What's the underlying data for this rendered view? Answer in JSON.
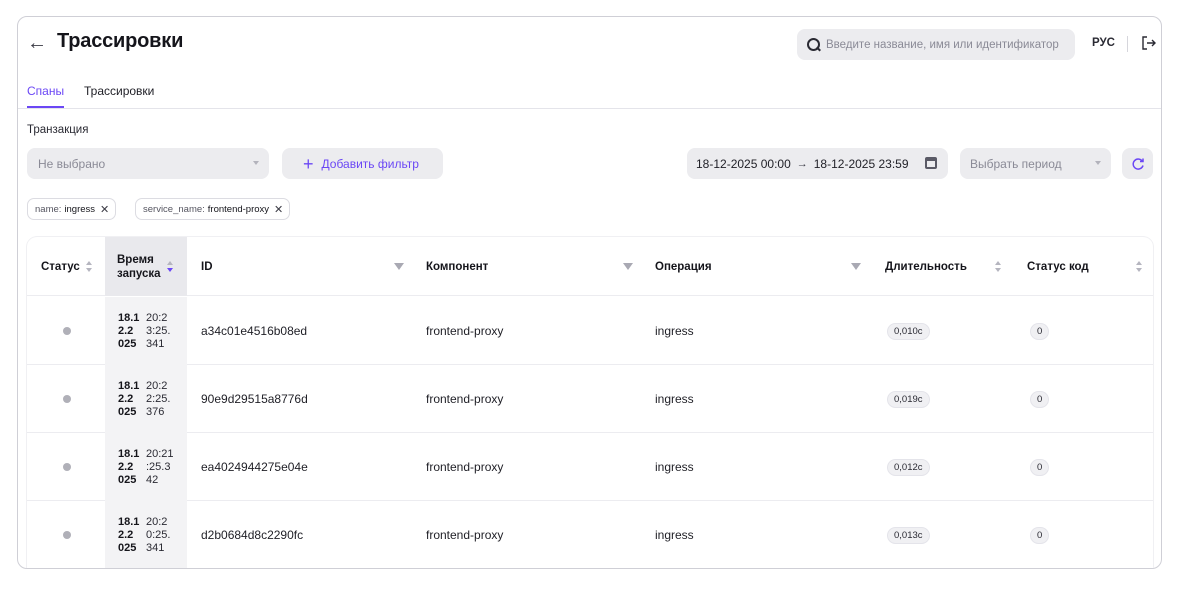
{
  "header": {
    "title": "Трассировки",
    "search_placeholder": "Введите название, имя или идентификатор",
    "language": "РУС"
  },
  "tabs": [
    {
      "label": "Спаны",
      "active": true
    },
    {
      "label": "Трассировки",
      "active": false
    }
  ],
  "filters": {
    "transaction_label": "Транзакция",
    "transaction_value": "Не выбрано",
    "add_filter_label": "Добавить фильтр",
    "date_from": "18-12-2025 00:00",
    "date_arrow": "→",
    "date_to": "18-12-2025 23:59",
    "period_placeholder": "Выбрать период",
    "chips": [
      {
        "key": "name:",
        "value": "ingress"
      },
      {
        "key": "service_name:",
        "value": "frontend-proxy"
      }
    ]
  },
  "table": {
    "columns": {
      "status": "Статус",
      "start_time_line1": "Время",
      "start_time_line2": "запуска",
      "id": "ID",
      "component": "Компонент",
      "operation": "Операция",
      "duration": "Длительность",
      "status_code": "Статус код"
    },
    "rows": [
      {
        "date": [
          "18.1",
          "2.2",
          "025"
        ],
        "time": [
          "20:2",
          "3:25.",
          "341"
        ],
        "id": "a34c01e4516b08ed",
        "component": "frontend-proxy",
        "operation": "ingress",
        "duration": "0,010с",
        "status_code": "0"
      },
      {
        "date": [
          "18.1",
          "2.2",
          "025"
        ],
        "time": [
          "20:2",
          "2:25.",
          "376"
        ],
        "id": "90e9d29515a8776d",
        "component": "frontend-proxy",
        "operation": "ingress",
        "duration": "0,019с",
        "status_code": "0"
      },
      {
        "date": [
          "18.1",
          "2.2",
          "025"
        ],
        "time": [
          "20:21",
          ":25.3",
          "42"
        ],
        "id": "ea4024944275e04e",
        "component": "frontend-proxy",
        "operation": "ingress",
        "duration": "0,012с",
        "status_code": "0"
      },
      {
        "date": [
          "18.1",
          "2.2",
          "025"
        ],
        "time": [
          "20:2",
          "0:25.",
          "341"
        ],
        "id": "d2b0684d8c2290fc",
        "component": "frontend-proxy",
        "operation": "ingress",
        "duration": "0,013с",
        "status_code": "0"
      }
    ]
  },
  "colors": {
    "accent": "#6b47f5",
    "field_bg": "#ececef",
    "status_dot": "#b0b0b8"
  }
}
